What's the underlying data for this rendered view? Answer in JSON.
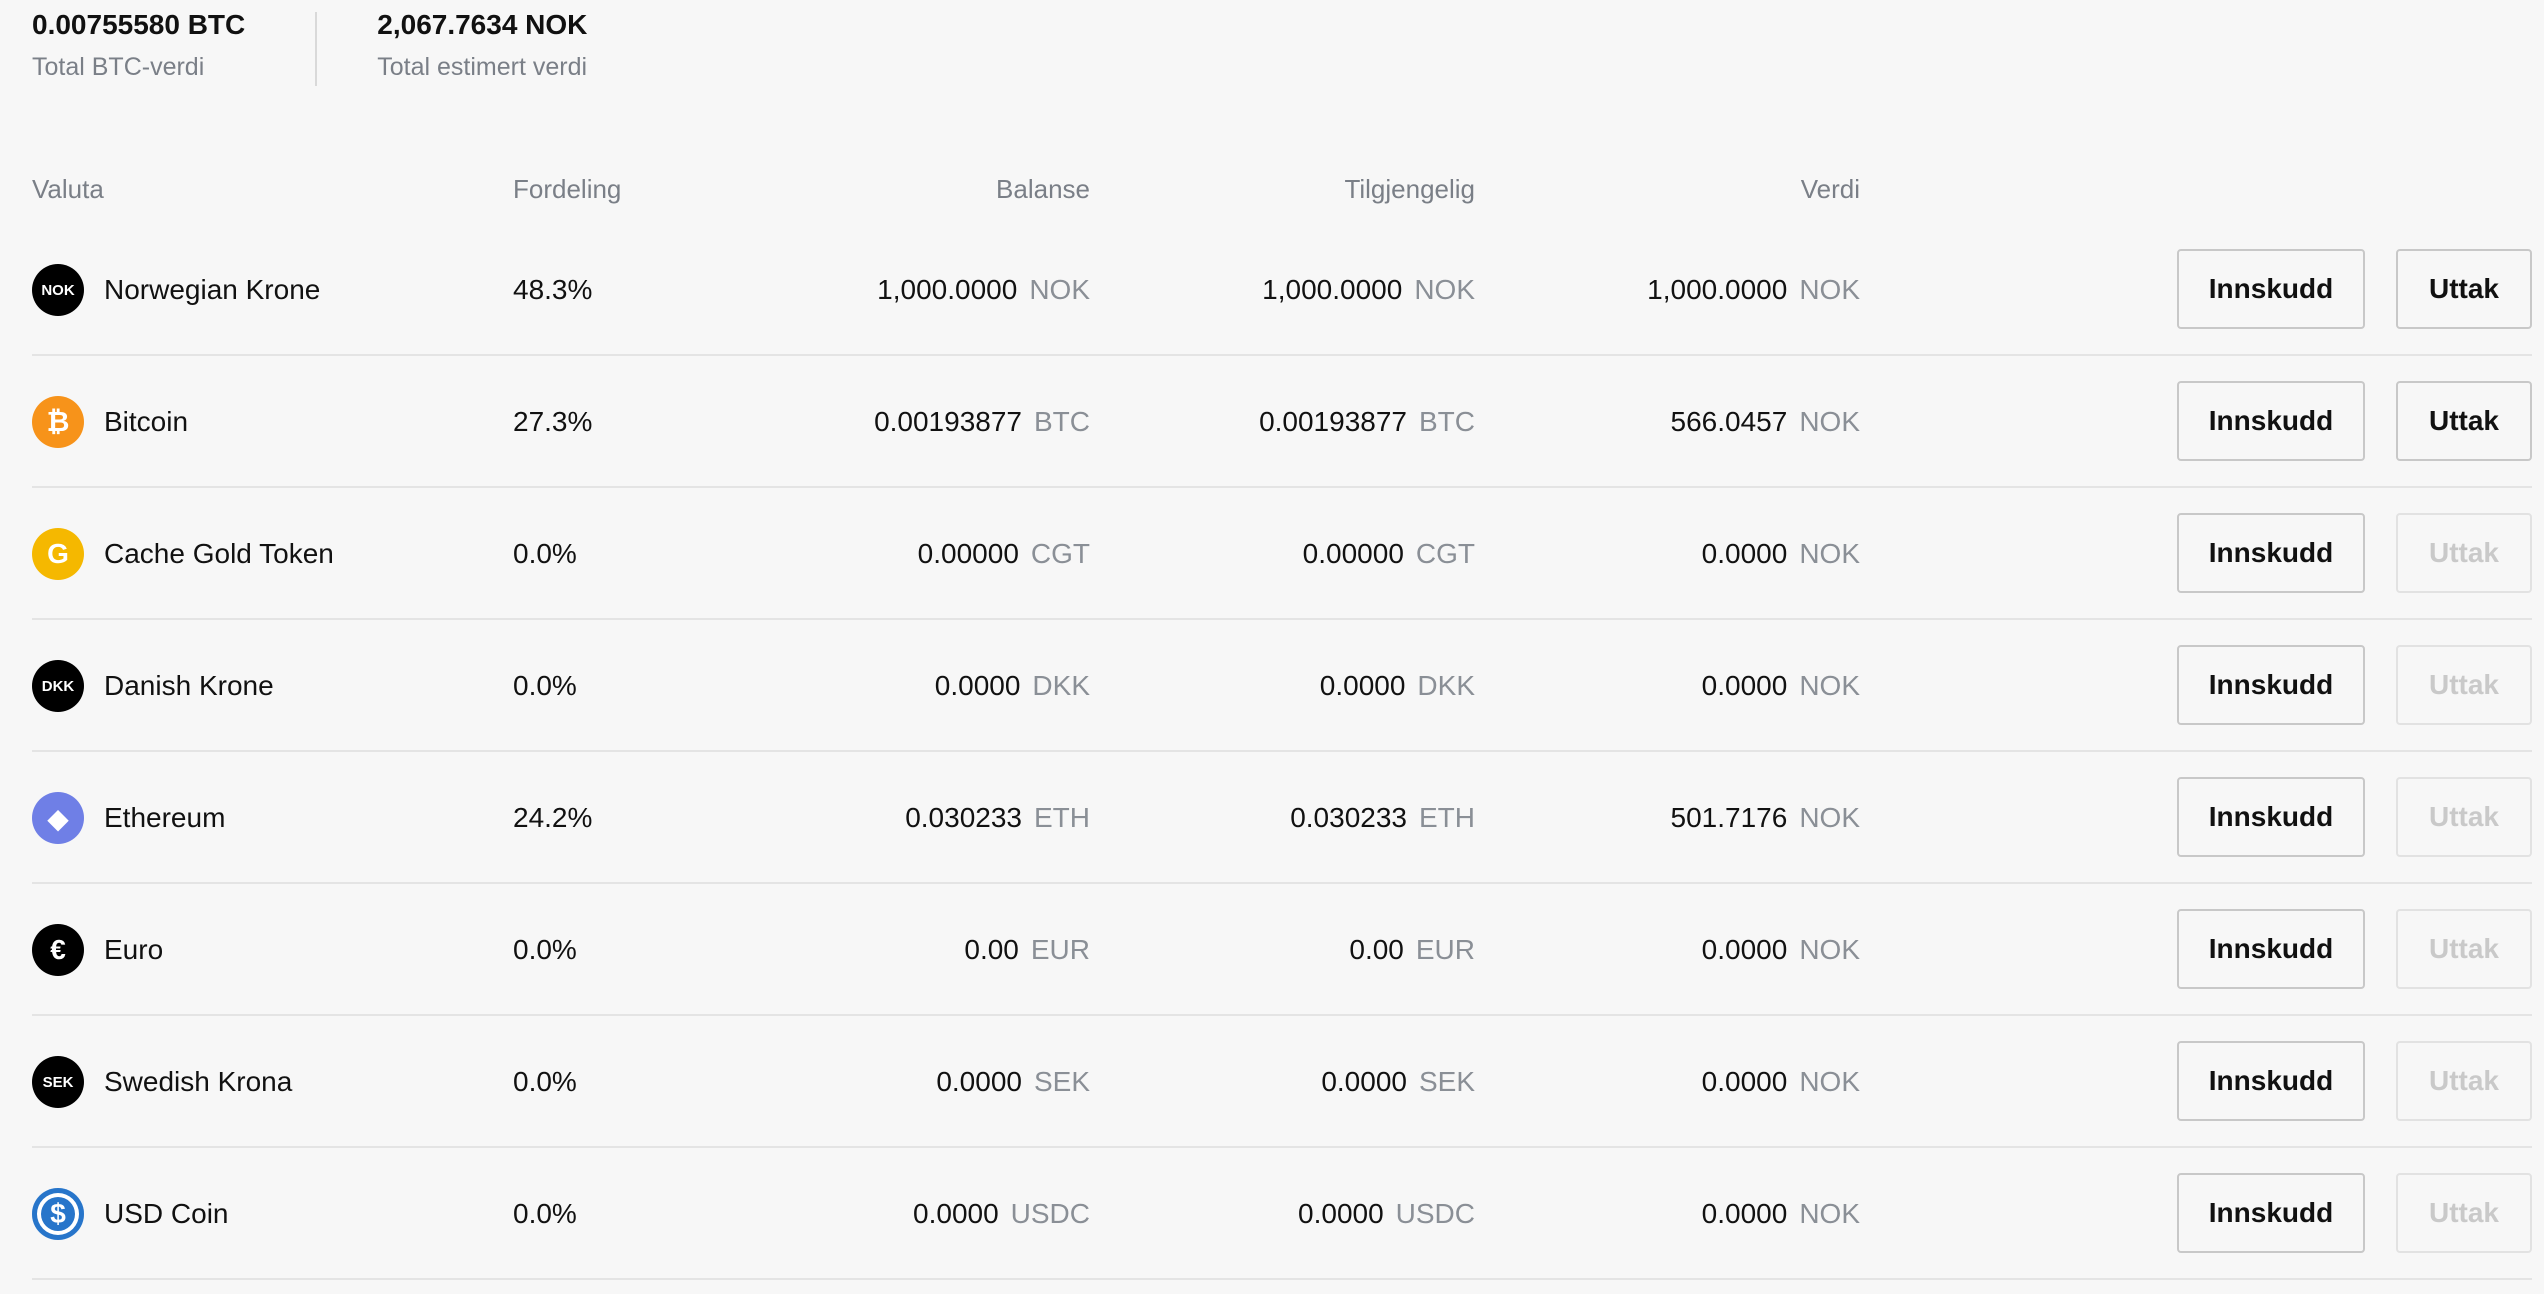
{
  "summary": {
    "btc_total_value": "0.00755580 BTC",
    "btc_total_label": "Total BTC-verdi",
    "estimated_value": "2,067.7634 NOK",
    "estimated_label": "Total estimert verdi"
  },
  "table": {
    "headers": {
      "currency": "Valuta",
      "distribution": "Fordeling",
      "balance": "Balanse",
      "available": "Tilgjengelig",
      "value": "Verdi"
    },
    "deposit_label": "Innskudd",
    "withdraw_label": "Uttak",
    "rows": [
      {
        "name": "Norwegian Krone",
        "icon": "NOK",
        "icon_name": "nok-icon",
        "icon_color": "#000000",
        "pct": "48.3%",
        "balance": "1,000.0000",
        "balance_unit": "NOK",
        "available": "1,000.0000",
        "available_unit": "NOK",
        "value": "1,000.0000",
        "value_unit": "NOK",
        "withdraw_enabled": true
      },
      {
        "name": "Bitcoin",
        "icon": "₿",
        "icon_name": "bitcoin-icon",
        "icon_color": "#f7931a",
        "pct": "27.3%",
        "balance": "0.00193877",
        "balance_unit": "BTC",
        "available": "0.00193877",
        "available_unit": "BTC",
        "value": "566.0457",
        "value_unit": "NOK",
        "withdraw_enabled": true
      },
      {
        "name": "Cache Gold Token",
        "icon": "G",
        "icon_name": "cache-gold-icon",
        "icon_color": "#f5b800",
        "pct": "0.0%",
        "balance": "0.00000",
        "balance_unit": "CGT",
        "available": "0.00000",
        "available_unit": "CGT",
        "value": "0.0000",
        "value_unit": "NOK",
        "withdraw_enabled": false
      },
      {
        "name": "Danish Krone",
        "icon": "DKK",
        "icon_name": "dkk-icon",
        "icon_color": "#000000",
        "pct": "0.0%",
        "balance": "0.0000",
        "balance_unit": "DKK",
        "available": "0.0000",
        "available_unit": "DKK",
        "value": "0.0000",
        "value_unit": "NOK",
        "withdraw_enabled": false
      },
      {
        "name": "Ethereum",
        "icon": "◆",
        "icon_name": "ethereum-icon",
        "icon_color": "#6f7fe6",
        "pct": "24.2%",
        "balance": "0.030233",
        "balance_unit": "ETH",
        "available": "0.030233",
        "available_unit": "ETH",
        "value": "501.7176",
        "value_unit": "NOK",
        "withdraw_enabled": false
      },
      {
        "name": "Euro",
        "icon": "€",
        "icon_name": "euro-icon",
        "icon_color": "#000000",
        "pct": "0.0%",
        "balance": "0.00",
        "balance_unit": "EUR",
        "available": "0.00",
        "available_unit": "EUR",
        "value": "0.0000",
        "value_unit": "NOK",
        "withdraw_enabled": false
      },
      {
        "name": "Swedish Krona",
        "icon": "SEK",
        "icon_name": "sek-icon",
        "icon_color": "#000000",
        "pct": "0.0%",
        "balance": "0.0000",
        "balance_unit": "SEK",
        "available": "0.0000",
        "available_unit": "SEK",
        "value": "0.0000",
        "value_unit": "NOK",
        "withdraw_enabled": false
      },
      {
        "name": "USD Coin",
        "icon": "$",
        "icon_name": "usd-coin-icon",
        "icon_color": "#2775ca",
        "pct": "0.0%",
        "balance": "0.0000",
        "balance_unit": "USDC",
        "available": "0.0000",
        "available_unit": "USDC",
        "value": "0.0000",
        "value_unit": "NOK",
        "withdraw_enabled": false
      }
    ]
  }
}
